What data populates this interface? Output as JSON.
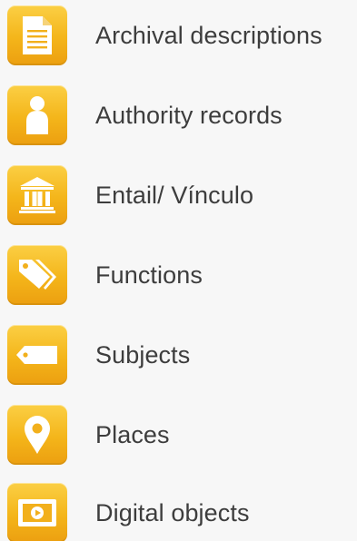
{
  "menu": {
    "items": [
      {
        "label": "Archival descriptions",
        "icon": "document-icon"
      },
      {
        "label": "Authority records",
        "icon": "person-icon"
      },
      {
        "label": "Entail/ Vínculo",
        "icon": "institution-icon"
      },
      {
        "label": "Functions",
        "icon": "tags-icon"
      },
      {
        "label": "Subjects",
        "icon": "tag-icon"
      },
      {
        "label": "Places",
        "icon": "map-pin-icon"
      },
      {
        "label": "Digital objects",
        "icon": "media-icon"
      }
    ]
  },
  "colors": {
    "icon_background": "#f4b51a",
    "icon_glyph": "#ffffff",
    "label_text": "#3d3d3d",
    "page_background": "#f7f7f7"
  }
}
